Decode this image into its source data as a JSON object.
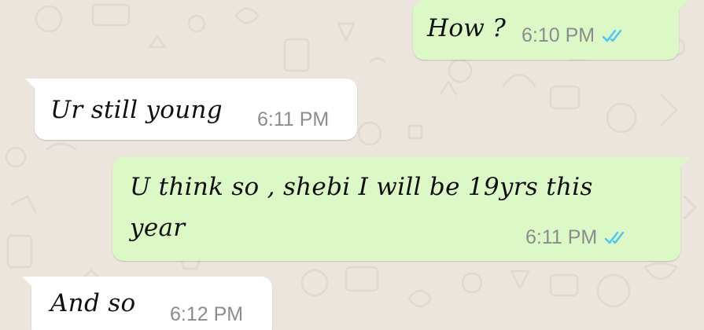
{
  "chat": {
    "messages": [
      {
        "direction": "outgoing",
        "text": "How ?",
        "time": "6:10 PM",
        "status": "read"
      },
      {
        "direction": "incoming",
        "text": "Ur still young",
        "time": "6:11 PM"
      },
      {
        "direction": "outgoing",
        "text_line1": "U think so , shebi I will be 19yrs this",
        "text_line2": "year",
        "time": "6:11 PM",
        "status": "read"
      },
      {
        "direction": "incoming",
        "text": "And so",
        "time": "6:12 PM"
      }
    ]
  },
  "colors": {
    "background": "#ece5dd",
    "incoming_bubble": "#ffffff",
    "outgoing_bubble": "#dcf8c6",
    "read_ticks": "#4fc3f7",
    "timestamp": "#8c8c8c"
  },
  "icons": {
    "read_receipt": "double-check-icon"
  }
}
